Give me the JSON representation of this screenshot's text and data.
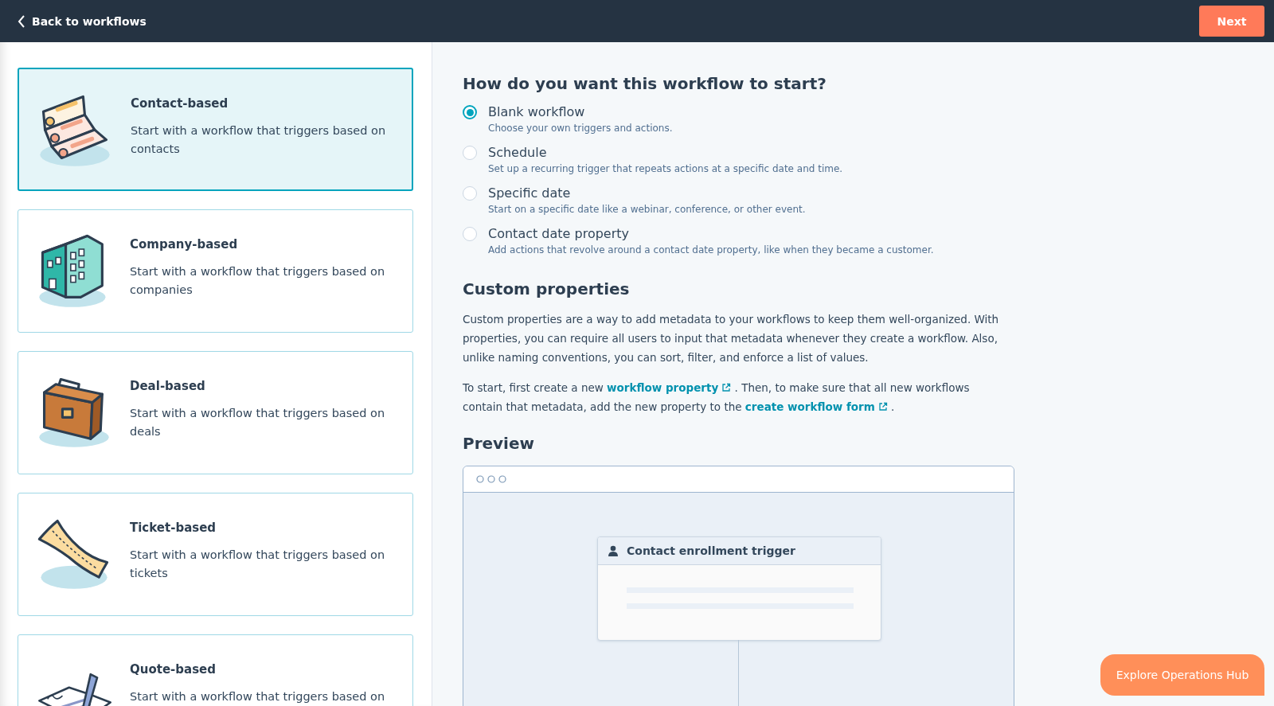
{
  "header": {
    "back_label": "Back to workflows",
    "next_button": "Next"
  },
  "types": [
    {
      "kind": "contact",
      "title": "Contact-based",
      "description": "Start with a workflow that triggers based on contacts",
      "selected": true
    },
    {
      "kind": "company",
      "title": "Company-based",
      "description": "Start with a workflow that triggers based on companies",
      "selected": false
    },
    {
      "kind": "deal",
      "title": "Deal-based",
      "description": "Start with a workflow that triggers based on deals",
      "selected": false
    },
    {
      "kind": "ticket",
      "title": "Ticket-based",
      "description": "Start with a workflow that triggers based on tickets",
      "selected": false
    },
    {
      "kind": "quote",
      "title": "Quote-based",
      "description": "Start with a workflow that triggers based on",
      "selected": false
    }
  ],
  "start": {
    "heading": "How do you want this workflow to start?",
    "options": [
      {
        "label": "Blank workflow",
        "hint": "Choose your own triggers and actions.",
        "selected": true
      },
      {
        "label": "Schedule",
        "hint": "Set up a recurring trigger that repeats actions at a specific date and time.",
        "selected": false
      },
      {
        "label": "Specific date",
        "hint": "Start on a specific date like a webinar, conference, or other event.",
        "selected": false
      },
      {
        "label": "Contact date property",
        "hint": "Add actions that revolve around a contact date property, like when they became a customer.",
        "selected": false
      }
    ]
  },
  "custom_properties": {
    "heading": "Custom properties",
    "paragraphs": [
      [
        {
          "kind": "text",
          "text": "Custom properties are a way to add metadata to your workflows to keep them well-organized. With properties, you can require all users to input that metadata whenever they create a workflow. Also, unlike naming conventions, you can sort, filter, and enforce a list of values."
        }
      ],
      [
        {
          "kind": "text",
          "text": "To start, first create a new "
        },
        {
          "kind": "link",
          "text": "workflow property"
        },
        {
          "kind": "text",
          "text": " . Then, to make sure that all new workflows contain that metadata, add the new property to the "
        },
        {
          "kind": "link",
          "text": "create workflow form"
        },
        {
          "kind": "text",
          "text": " ."
        }
      ]
    ]
  },
  "preview": {
    "heading": "Preview",
    "trigger_title": "Contact enrollment trigger"
  },
  "explore_button": "Explore Operations Hub"
}
